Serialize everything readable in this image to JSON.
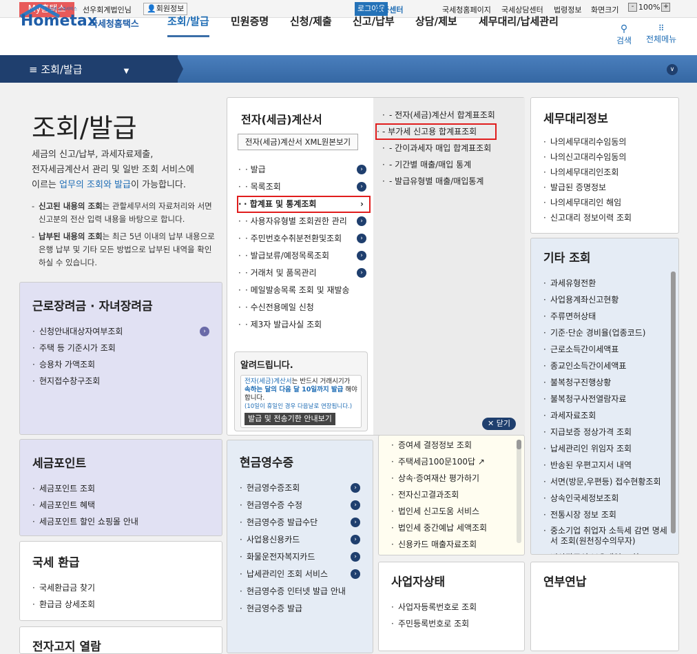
{
  "topbar": {
    "my": "My홈택스",
    "user": "선우회계법인님",
    "member": "회원정보",
    "logout": "로그아웃",
    "cert": "인증센터",
    "links": [
      "국세청홈페이지",
      "국세상담센터",
      "법령정보",
      "화면크기"
    ],
    "zoom": "100%",
    "minus": "-",
    "plus": "+"
  },
  "header": {
    "logo_small": "인터넷 납세서비스",
    "logo_main": "Hometax",
    "logo_kr": "국세청홈택스",
    "nav": [
      "조회/발급",
      "민원증명",
      "신청/제출",
      "신고/납부",
      "상담/제보",
      "세무대리/납세관리"
    ],
    "search": "검색",
    "allmenu": "전체메뉴"
  },
  "navbar": {
    "title": "조회/발급"
  },
  "intro": {
    "title": "조회/발급",
    "desc1": "세금의 신고/납부, 과세자료제출,",
    "desc2": "전자세금계산서 관리 및 일반 조회 서비스에",
    "desc3a": "이르는 ",
    "desc3b": "업무의 조회와 발급",
    "desc3c": "이 가능합니다.",
    "note1b": "신고된 내용의 조회",
    "note1": "는 관할세무서의 자료처리와 서면신고분의 전산 입력 내용을 바탕으로 합니다.",
    "note2b": "납부된 내용의 조회",
    "note2": "는 최근 5년 이내의 납부 내용으로 은행 납부 및 기타 모든 방법으로 납부된 내역을 확인하실 수 있습니다."
  },
  "eitc": {
    "title": "근로장려금 · 자녀장려금",
    "items": [
      "신청안내대상자여부조회",
      "주택 등 기준시가 조회",
      "승용차 가액조회",
      "현지접수창구조회"
    ]
  },
  "point": {
    "title": "세금포인트",
    "items": [
      "세금포인트 조회",
      "세금포인트 혜택",
      "세금포인트 할인 쇼핑몰 안내"
    ]
  },
  "refund": {
    "title": "국세 환급",
    "items": [
      "국세환급금 찾기",
      "환급금 상세조회"
    ]
  },
  "enotice": {
    "title": "전자고지 열람"
  },
  "einvoice": {
    "title": "전자(세금)계산서",
    "xml_button": "전자(세금)계산서 XML원본보기",
    "items": [
      "발급",
      "목록조회",
      "합계표 및 통계조회",
      "사용자유형별 조회권한 관리",
      "주민번호수취분전환및조회",
      "발급보류/예정목록조회",
      "거래처 및 품목관리",
      "메일발송목록 조회 및 재발송",
      "수신전용메일 신청",
      "제3자 발급사실 조회"
    ],
    "sub": [
      "전자(세금)계산서 합계표조회",
      "부가세 신고용 합계표조회",
      "간이과세자 매입 합계표조회",
      "기간별 매출/매입 통계",
      "발급유형별 매출/매입통계"
    ],
    "notice_title": "알려드립니다.",
    "notice1": "전자(세금)계산서",
    "notice2": "는 반드시 거래시기가",
    "notice3": "속하는 달의 다음 달 10일까지 발급",
    "notice4": " 해야 합니다.",
    "notice5": "(10일이 휴일인 경우 다음날로 연장됩니다.)",
    "notice_button": "발급 및 전송기한 안내보기",
    "close": "닫기"
  },
  "agent": {
    "title": "세무대리정보",
    "items": [
      "나의세무대리수임동의",
      "나의신고대리수임동의",
      "나의세무대리인조회",
      "발급된 증명정보",
      "나의세무대리인 해임",
      "신고대리 정보이력 조회"
    ]
  },
  "other": {
    "title": "기타 조회",
    "items": [
      "과세유형전환",
      "사업용계좌신고현황",
      "주류면허상태",
      "기준·단순 경비율(업종코드)",
      "근로소득간이세액표",
      "종교인소득간이세액표",
      "불복청구진행상황",
      "불복청구사전열람자료",
      "과세자료조회",
      "지급보증 정상가격 조회",
      "납세관리인 위임자 조회",
      "반송된 우편고지서 내역",
      "서면(방문,우편등) 접수현황조회",
      "상속인국세정보조회",
      "전통시장 정보 조회",
      "중소기업 취업자 소득세 감면 명세서 조회(원천징수의무자)",
      "비상장주식 보유내역 조회"
    ]
  },
  "cash": {
    "title": "현금영수증",
    "items": [
      "현금영수증조회",
      "현금영수증 수정",
      "현금영수증 발급수단",
      "사업용신용카드",
      "화물운전자복지카드",
      "납세관리인 조회 서비스",
      "현금영수증 인터넷 발급 안내",
      "현금영수증 발급"
    ]
  },
  "misc": {
    "items": [
      "증여세 결정정보 조회",
      "주택세금100문100답",
      "상속·증여재산 평가하기",
      "전자신고결과조회",
      "법인세 신고도움 서비스",
      "법인세 중간예납 세액조회",
      "신용카드 매출자료조회"
    ]
  },
  "biz": {
    "title": "사업자상태",
    "items": [
      "사업자등록번호로 조회",
      "주민등록번호로 조회"
    ]
  },
  "install": {
    "title": "연부연납"
  }
}
